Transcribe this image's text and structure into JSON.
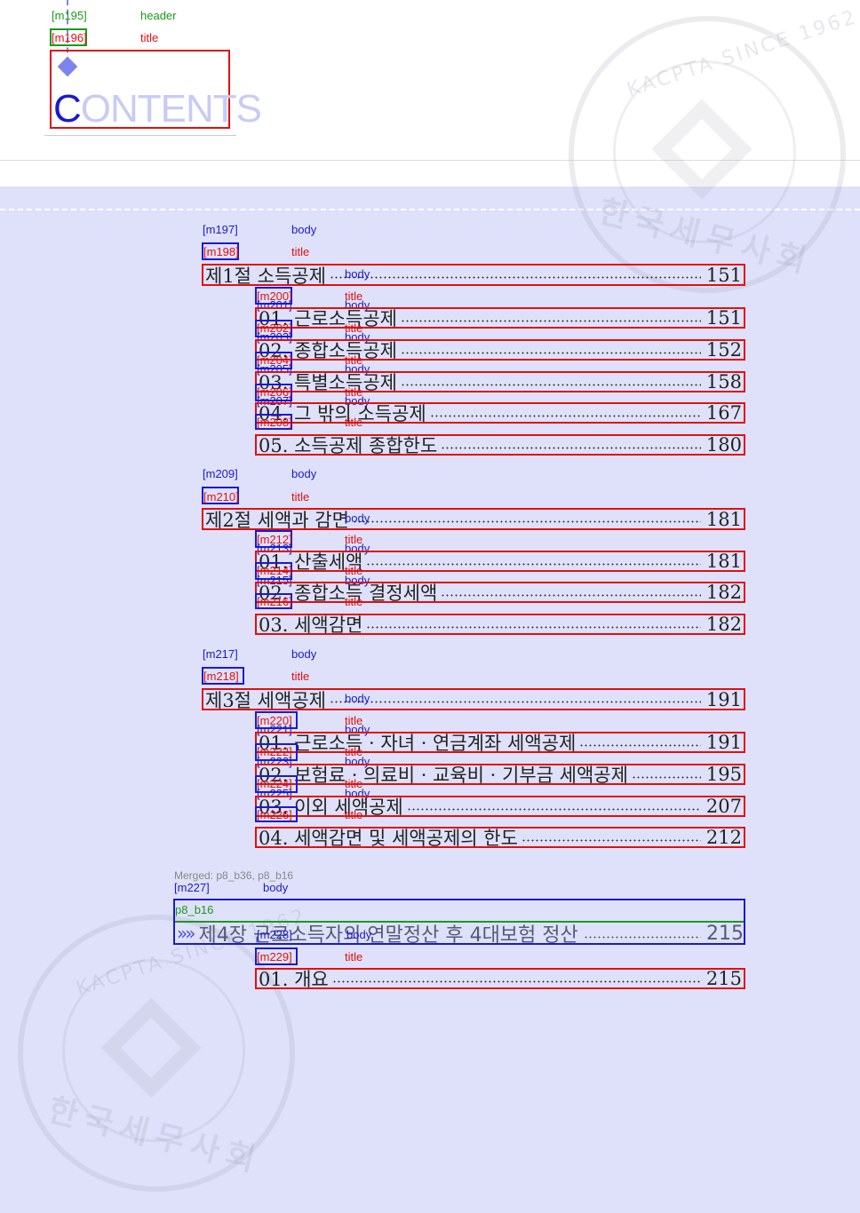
{
  "header": {
    "header_tag": "[m195]",
    "header_type": "header",
    "title_tag": "[m196]",
    "title_type": "title",
    "contents_first": "C",
    "contents_rest": "ONTENTS"
  },
  "watermark": {
    "top_text": "KACPTA SINCE 1962",
    "bottom_text": "한국세무사회"
  },
  "sections": [
    {
      "tag": "[m197]",
      "type": "body",
      "title_tag": "[m198]",
      "title_type": "title",
      "label": "제1절 소득공제",
      "label_type": "body",
      "page": "151",
      "items": [
        {
          "tag": "[m200]",
          "type": "title",
          "body_tag": "[m201]",
          "body_type": "body",
          "label": "01. 근로소득공제",
          "page": "151"
        },
        {
          "tag": "[m202]",
          "type": "title",
          "body_tag": "[m203]",
          "body_type": "body",
          "label": "02. 종합소득공제",
          "page": "152"
        },
        {
          "tag": "[m204]",
          "type": "title",
          "body_tag": "[m205]",
          "body_type": "body",
          "label": "03. 특별소득공제",
          "page": "158"
        },
        {
          "tag": "[m206]",
          "type": "title",
          "body_tag": "[m207]",
          "body_type": "body",
          "label": "04. 그 밖의 소득공제",
          "page": "167"
        },
        {
          "tag": "[m208]",
          "type": "title",
          "body_tag": "",
          "body_type": "",
          "label": "05. 소득공제 종합한도",
          "page": "180"
        }
      ]
    },
    {
      "tag": "[m209]",
      "type": "body",
      "title_tag": "[m210]",
      "title_type": "title",
      "label": "제2절 세액과 감면",
      "label_type": "body",
      "page": "181",
      "items": [
        {
          "tag": "[m212]",
          "type": "title",
          "body_tag": "[m213]",
          "body_type": "body",
          "label": "01. 산출세액",
          "page": "181"
        },
        {
          "tag": "[m214]",
          "type": "title",
          "body_tag": "[m215]",
          "body_type": "body",
          "label": "02. 종합소득 결정세액",
          "page": "182"
        },
        {
          "tag": "[m216]",
          "type": "title",
          "body_tag": "",
          "body_type": "",
          "label": "03. 세액감면",
          "page": "182"
        }
      ]
    },
    {
      "tag": "[m217]",
      "type": "body",
      "title_tag": "[m218]",
      "title_type": "title",
      "label": "제3절 세액공제",
      "label_type": "body",
      "page": "191",
      "items": [
        {
          "tag": "[m220]",
          "type": "title",
          "body_tag": "[m221]",
          "body_type": "body",
          "label": "01. 근로소득 · 자녀 · 연금계좌 세액공제",
          "page": "191"
        },
        {
          "tag": "[m222]",
          "type": "title",
          "body_tag": "[m223]",
          "body_type": "body",
          "label": "02. 보험료 · 의료비 · 교육비 · 기부금 세액공제",
          "page": "195"
        },
        {
          "tag": "[m224]",
          "type": "title",
          "body_tag": "[m225]",
          "body_type": "body",
          "label": "03. 이외 세액공제",
          "page": "207"
        },
        {
          "tag": "[m226]",
          "type": "title",
          "body_tag": "",
          "body_type": "",
          "label": "04. 세액감면 및 세액공제의 한도",
          "page": "212"
        }
      ]
    }
  ],
  "chapter": {
    "merged_note": "Merged: p8_b36, p8_b16",
    "tag": "[m227]",
    "type": "body",
    "block_tag": "p8_b16",
    "arrows": "»»",
    "inner_tag": "[m228]",
    "inner_type": "body",
    "label": "제4장 근로소득자의 연말정산 후 4대보험 정산",
    "page": "215",
    "item": {
      "tag": "[m229]",
      "type": "title",
      "label": "01. 개요",
      "page": "215"
    }
  }
}
